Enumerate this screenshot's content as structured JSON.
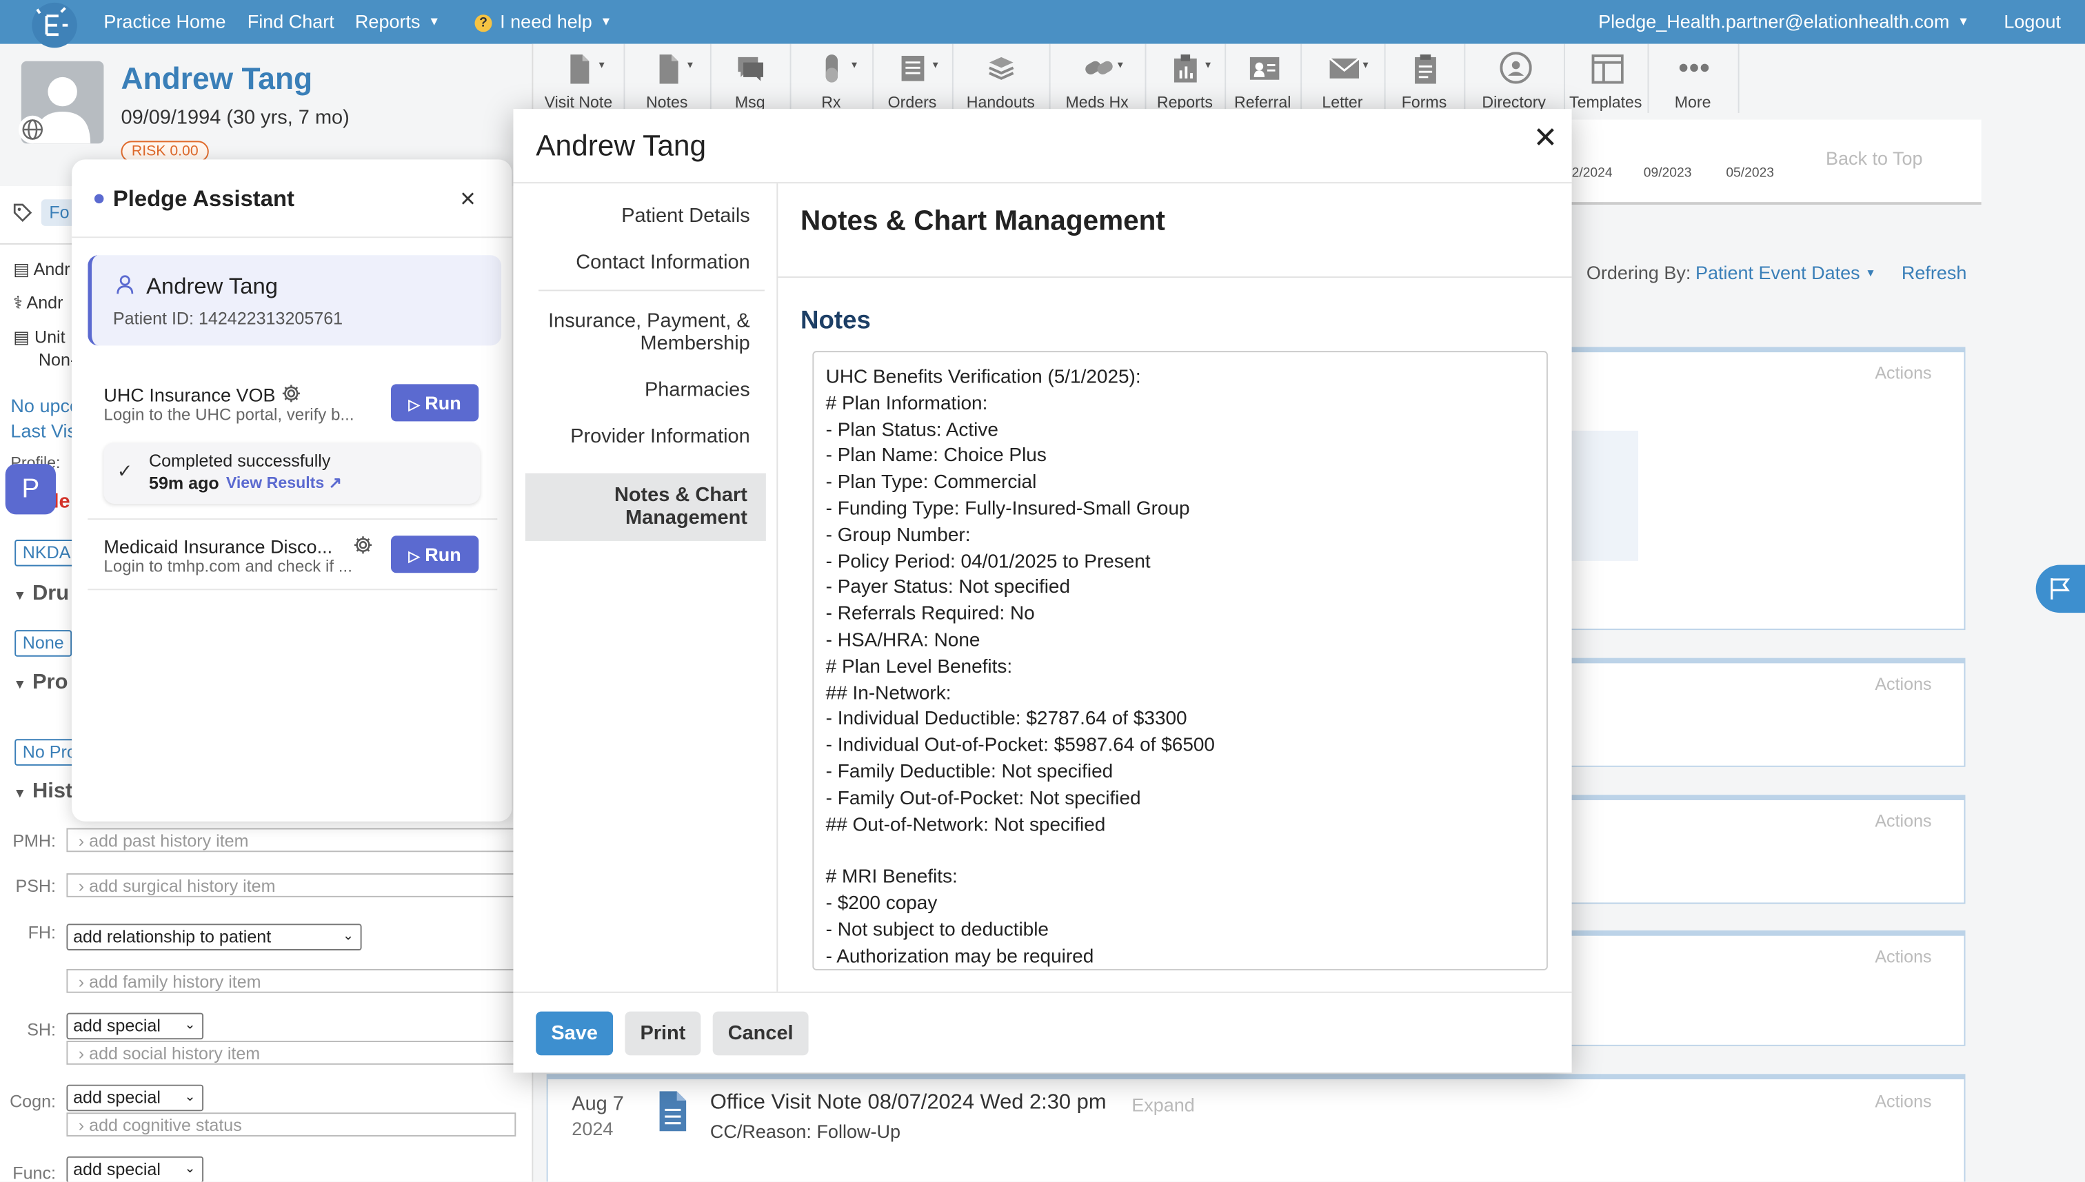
{
  "topnav": {
    "practice_home": "Practice Home",
    "find_chart": "Find Chart",
    "reports": "Reports",
    "help": "I need help",
    "help_mark": "?",
    "user_email": "Pledge_Health.partner@elationhealth.com",
    "logout": "Logout"
  },
  "patient": {
    "name": "Andrew Tang",
    "dob": "09/09/1994 (30 yrs, 7 mo)",
    "risk": "RISK 0.00"
  },
  "toolbar": {
    "items": [
      {
        "label": "Visit Note",
        "icon": "visit-note-icon"
      },
      {
        "label": "Notes",
        "icon": "notes-icon"
      },
      {
        "label": "Msg",
        "icon": "message-icon"
      },
      {
        "label": "Rx",
        "icon": "rx-icon"
      },
      {
        "label": "Orders",
        "icon": "orders-icon"
      },
      {
        "label": "Handouts",
        "icon": "handouts-icon"
      },
      {
        "label": "Meds Hx",
        "icon": "meds-hx-icon"
      },
      {
        "label": "Reports",
        "icon": "reports-icon"
      },
      {
        "label": "Referral",
        "icon": "referral-icon"
      },
      {
        "label": "Letter",
        "icon": "letter-icon"
      },
      {
        "label": "Forms",
        "icon": "forms-icon"
      },
      {
        "label": "Directory",
        "icon": "directory-icon"
      },
      {
        "label": "Templates",
        "icon": "templates-icon"
      },
      {
        "label": "More",
        "icon": "more-icon"
      }
    ]
  },
  "timeline": {
    "ticks": [
      "2/2024",
      "09/2023",
      "05/2023"
    ],
    "back_to_top": "Back to Top"
  },
  "ordering": {
    "label": "Ordering By:",
    "value": "Patient Event Dates",
    "refresh": "Refresh"
  },
  "actions_label": "Actions",
  "left_sidebar": {
    "tab_fragment": "Fo",
    "info_rows": [
      "Andr",
      "Andr",
      "Unit",
      "Non-"
    ],
    "no_upcoming": "No upco",
    "last_visit": "Last Visi",
    "profile": "Profile:",
    "allergy_fragment": "lle",
    "nkda": "NKDA",
    "drug_section": "Dru",
    "none_badge": "None",
    "problem_section": "Pro",
    "no_problems": "No Pro",
    "history_section": "Hist",
    "pmh_label": "PMH:",
    "pmh_placeholder": "add past history item",
    "psh_label": "PSH:",
    "psh_placeholder": "add surgical history item",
    "fh_label": "FH:",
    "fh_select": "add relationship to patient",
    "fh_placeholder": "add family history item",
    "sh_label": "SH:",
    "sh_select": "add special",
    "sh_placeholder": "add social history item",
    "cogn_label": "Cogn:",
    "cogn_select": "add special",
    "cogn_placeholder": "add cognitive status",
    "func_label": "Func:",
    "func_select": "add special"
  },
  "pledge_assistant": {
    "title": "Pledge Assistant",
    "patient_name": "Andrew Tang",
    "patient_id": "Patient ID: 142422313205761",
    "workflows": [
      {
        "name": "UHC Insurance VOB",
        "description": "Login to the UHC portal, verify b...",
        "run_label": "Run"
      },
      {
        "name": "Medicaid Insurance Disco...",
        "description": "Login to tmhp.com and check if ...",
        "run_label": "Run"
      }
    ],
    "status": {
      "text": "Completed successfully",
      "time": "59m ago",
      "view_results": "View Results"
    },
    "launcher_label": "P"
  },
  "modal": {
    "title": "Andrew Tang",
    "nav": [
      "Patient Details",
      "Contact Information",
      "Insurance, Payment, & Membership",
      "Pharmacies",
      "Provider Information",
      "Notes & Chart Management"
    ],
    "section_title": "Notes & Chart Management",
    "notes_heading": "Notes",
    "notes_lines": [
      "UHC Benefits Verification (5/1/2025):",
      "# Plan Information:",
      "- Plan Status: Active",
      "- Plan Name: Choice Plus",
      "- Plan Type: Commercial",
      "- Funding Type: Fully-Insured-Small Group",
      "- Group Number:",
      "- Policy Period: 04/01/2025 to Present",
      "- Payer Status: Not specified",
      "- Referrals Required: No",
      "- HSA/HRA: None",
      "# Plan Level Benefits:",
      "## In-Network:",
      "- Individual Deductible: $2787.64 of $3300",
      "- Individual Out-of-Pocket: $5987.64 of $6500",
      "- Family Deductible: Not specified",
      "- Family Out-of-Pocket: Not specified",
      "## Out-of-Network: Not specified",
      "",
      "# MRI Benefits:",
      "- $200 copay",
      "- Not subject to deductible",
      "- Authorization may be required"
    ],
    "save": "Save",
    "print": "Print",
    "cancel": "Cancel"
  },
  "visit_note": {
    "month_day": "Aug 7",
    "year": "2024",
    "title": "Office Visit Note 08/07/2024 Wed 2:30 pm",
    "expand": "Expand",
    "reason": "CC/Reason: Follow-Up"
  },
  "colors": {
    "nav_blue": "#4a90c4",
    "link_blue": "#3a7fb8",
    "run_purple": "#5b6ad0",
    "save_blue": "#3d8fcf",
    "risk_orange": "#e06a2b"
  }
}
